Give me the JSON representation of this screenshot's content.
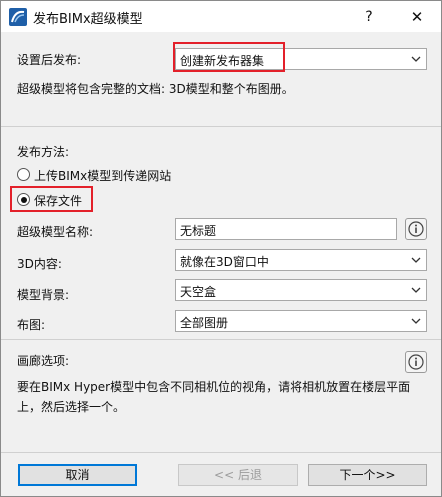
{
  "window": {
    "title": "发布BIMx超级模型",
    "help_glyph": "?",
    "close_glyph": "✕",
    "brand_color": "#2b6cb0"
  },
  "publish_settings": {
    "label": "设置后发布:",
    "selected": "创建新发布器集",
    "note": "超级模型将包含完整的文档: 3D模型和整个布图册。"
  },
  "publish_method": {
    "heading": "发布方法:",
    "options": [
      {
        "label": "上传BIMx模型到传递网站",
        "selected": false
      },
      {
        "label": "保存文件",
        "selected": true
      }
    ]
  },
  "fields": {
    "name_label": "超级模型名称:",
    "name_value": "无标题",
    "content_label": "3D内容:",
    "content_value": "就像在3D窗口中",
    "background_label": "模型背景:",
    "background_value": "天空盒",
    "layout_label": "布图:",
    "layout_value": "全部图册"
  },
  "gallery": {
    "heading": "画廊选项:",
    "description": "要在BIMx Hyper模型中包含不同相机位的视角，请将相机放置在楼层平面上，然后选择一个。"
  },
  "footer": {
    "cancel_label": "取消",
    "back_label": "<< 后退",
    "next_label": "下一个>>"
  },
  "highlight_color": "#e3202a"
}
